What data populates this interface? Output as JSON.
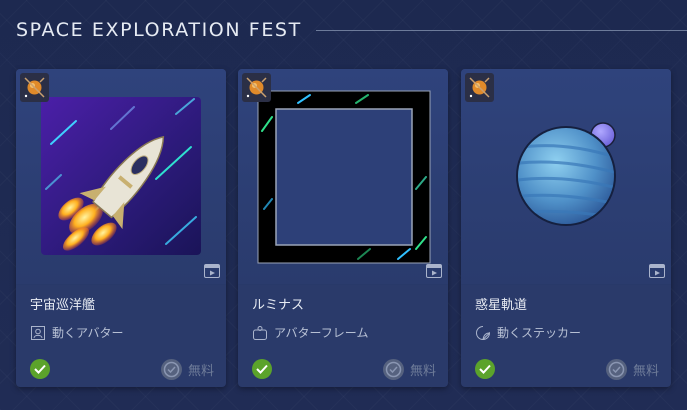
{
  "header": {
    "title": "SPACE EXPLORATION FEST"
  },
  "items": [
    {
      "name": "宇宙巡洋艦",
      "type_label": "動くアバター",
      "type_icon": "avatar-icon",
      "price": "無料",
      "owned": true
    },
    {
      "name": "ルミナス",
      "type_label": "アバターフレーム",
      "type_icon": "frame-icon",
      "price": "無料",
      "owned": true
    },
    {
      "name": "惑星軌道",
      "type_label": "動くステッカー",
      "type_icon": "sticker-icon",
      "price": "無料",
      "owned": true
    }
  ],
  "colors": {
    "owned_green": "#5ba32b",
    "card_bg": "#2a3a6a",
    "page_bg": "#1e2b52"
  }
}
